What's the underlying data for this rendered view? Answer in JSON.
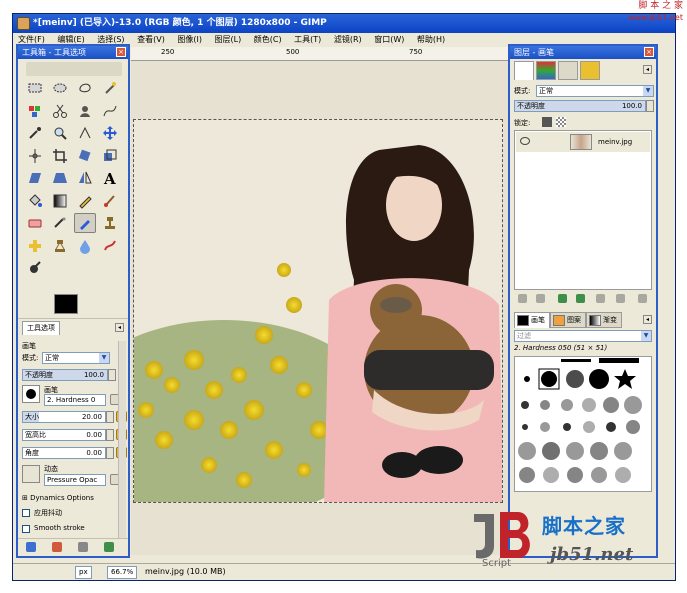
{
  "window": {
    "title": "*[meinv] (已导入)-13.0 (RGB 颜色, 1 个图层) 1280x800 - GIMP"
  },
  "menu": [
    "文件(F)",
    "编辑(E)",
    "选择(S)",
    "查看(V)",
    "图像(I)",
    "图层(L)",
    "颜色(C)",
    "工具(T)",
    "滤镜(R)",
    "窗口(W)",
    "帮助(H)"
  ],
  "ruler": [
    "250",
    "500",
    "750"
  ],
  "toolbox": {
    "title": "工具箱 - 工具选项",
    "tools": [
      "rect-select",
      "ellipse-select",
      "free-select",
      "fuzzy-select",
      "by-color-select",
      "scissors",
      "foreground-select",
      "paths",
      "color-picker",
      "zoom",
      "measure",
      "move",
      "align",
      "crop",
      "rotate",
      "scale",
      "shear",
      "perspective",
      "flip",
      "text",
      "bucket-fill",
      "blend",
      "pencil",
      "paintbrush",
      "eraser",
      "airbrush",
      "ink",
      "clone",
      "heal",
      "perspective-clone",
      "blur",
      "smudge",
      "dodge-burn"
    ],
    "foreground_color": "#000000",
    "background_color": "#ffffff"
  },
  "tool_options": {
    "tab_label": "工具选项",
    "section_title": "画笔",
    "mode_label": "模式:",
    "mode_value": "正常",
    "opacity_label": "不透明度",
    "opacity_value": "100.0",
    "brush_label": "画笔",
    "brush_value": "2. Hardness 0",
    "size_label": "大小",
    "size_value": "20.00",
    "aspect_label": "宽高比",
    "aspect_value": "0.00",
    "angle_label": "角度",
    "angle_value": "0.00",
    "dynamics_label": "动态",
    "dynamics_value": "Pressure Opac",
    "dynamics_options": "Dynamics Options",
    "jitter_label": "应用抖动",
    "smooth_label": "Smooth stroke"
  },
  "layers": {
    "title": "图层 - 画笔",
    "mode_label": "模式:",
    "mode_value": "正常",
    "opacity_label": "不透明度",
    "opacity_value": "100.0",
    "lock_label": "锁定:",
    "layer_name": "meinv.jpg"
  },
  "brushes": {
    "tabs": [
      "画笔",
      "图案",
      "渐变"
    ],
    "filter_placeholder": "过滤",
    "current": "2. Hardness 050 (51 × 51)"
  },
  "status": {
    "unit": "px",
    "zoom": "66.7%",
    "info": "meinv.jpg (10.0 MB)"
  },
  "watermark": {
    "top_line1": "脚 本 之 家",
    "top_line2": "www.Jb51.net",
    "logo_cn": "脚本之家",
    "logo_net": "jb51.net",
    "logo_script": "Script"
  }
}
